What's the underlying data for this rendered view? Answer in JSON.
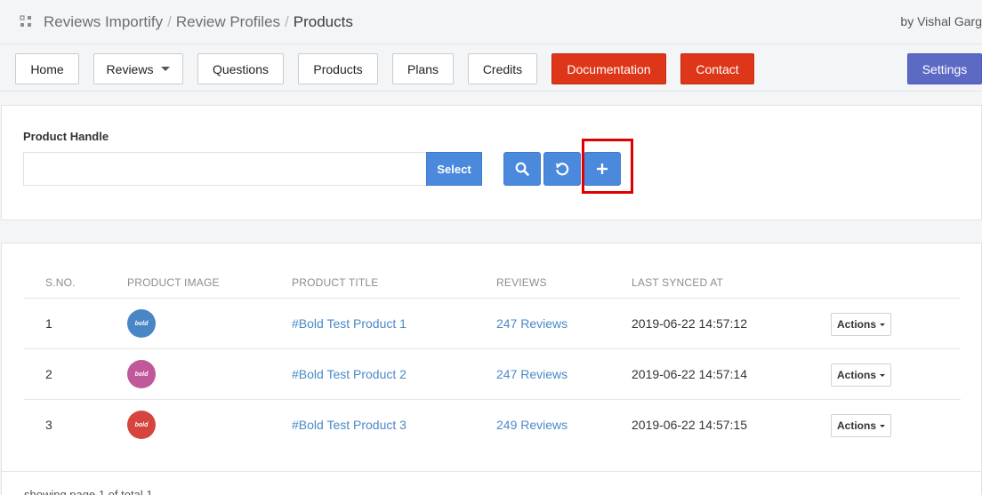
{
  "header": {
    "breadcrumbs": [
      "Reviews Importify",
      "Review Profiles",
      "Products"
    ],
    "author": "by Vishal Garg"
  },
  "nav": {
    "home": "Home",
    "reviews": "Reviews",
    "questions": "Questions",
    "products": "Products",
    "plans": "Plans",
    "credits": "Credits",
    "documentation": "Documentation",
    "contact": "Contact",
    "settings": "Settings"
  },
  "filter": {
    "label": "Product Handle",
    "value": "",
    "select_label": "Select"
  },
  "table": {
    "columns": [
      "S.NO.",
      "PRODUCT IMAGE",
      "PRODUCT TITLE",
      "REVIEWS",
      "LAST SYNCED AT"
    ],
    "rows": [
      {
        "sno": "1",
        "image_text": "bold",
        "image_color": "#4a86c5",
        "title": "#Bold Test Product 1",
        "reviews": "247 Reviews",
        "synced": "2019-06-22 14:57:12",
        "action": "Actions"
      },
      {
        "sno": "2",
        "image_text": "bold",
        "image_color": "#c0589a",
        "title": "#Bold Test Product 2",
        "reviews": "247 Reviews",
        "synced": "2019-06-22 14:57:14",
        "action": "Actions"
      },
      {
        "sno": "3",
        "image_text": "bold",
        "image_color": "#d6453d",
        "title": "#Bold Test Product 3",
        "reviews": "249 Reviews",
        "synced": "2019-06-22 14:57:15",
        "action": "Actions"
      }
    ]
  },
  "footer": {
    "paging": "showing page 1 of total 1"
  },
  "colors": {
    "primary": "#4a89dc",
    "danger": "#de3618",
    "settings": "#5c6ac4",
    "link": "#4a89c8"
  },
  "icons": [
    "apps-grid-icon",
    "search-icon",
    "reset-icon",
    "plus-icon",
    "chevron-down-icon"
  ]
}
